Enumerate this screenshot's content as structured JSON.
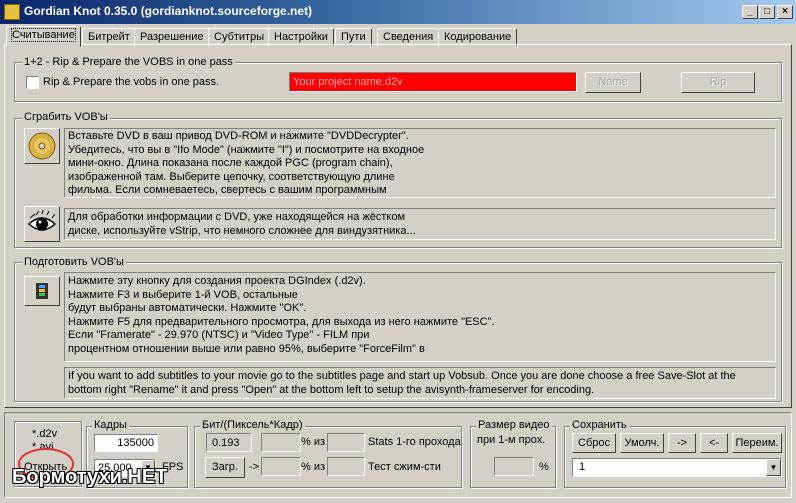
{
  "window": {
    "title": "Gordian Knot 0.35.0  (gordianknot.sourceforge.net)",
    "min": "_",
    "max": "□",
    "close": "×"
  },
  "tabs": [
    "Считывание",
    "Битрейт",
    "Разрешение",
    "Субтитры",
    "Настройки",
    "Пути",
    "Сведения",
    "Кодирование"
  ],
  "rip_group": {
    "legend": "1+2 - Rip & Prepare the VOBS in one pass",
    "checkbox_label": "Rip & Prepare the vobs in one pass.",
    "project_placeholder": "Your project name.d2v",
    "name_button": "Name",
    "rip_button": "Rip"
  },
  "grab_group": {
    "legend": "Сграбить VOB'ы",
    "dvd_text": "Вставьте DVD в ваш привод DVD-ROM и нажмите \"DVDDecrypter\". Убедитесь, что вы в \"Ifo Mode\" (нажмите \"I\") и посмотрите на входное мини-окно. Длина показана после каждой PGC (program chain), изображенной там. Выберите цепочку, соответствующую длине фильма. Если сомневаетесь, свертесь с вашим программным",
    "vstrip_text": "Для обработки информации с DVD, уже находящейся на жёстком диске, используйте vStrip, что немного сложнее для виндузятника..."
  },
  "prepare_group": {
    "legend": "Подготовить VOB'ы",
    "lines": [
      "Нажмите эту кнопку для создания проекта DGIndex (.d2v).",
      "Нажмите F3 и выберите 1-й VOB, остальные",
      "будут выбраны автоматически. Нажмите \"OK\".",
      "Нажмите F5 для предварительного просмотра, для выхода из него нажмите \"ESC\".",
      "Если \"Framerate\" - 29.970 (NTSC) и \"Video Type\" - FILM при",
      "процентном отношении выше или равно 95%, выберите \"ForceFilm\" в"
    ],
    "subtitle_note": "If you want to add subtitles to your movie go to the subtitles page and start up Vobsub. Once you are done choose a free Save-Slot at the bottom right \"Rename\" it and press \"Open\" at the bottom left to setup the avisynth-frameserver for encoding."
  },
  "bottom": {
    "ext_d2v": "*.d2v",
    "ext_avi": "*.avi",
    "open_button": "Открыть",
    "frames_label": "Кадры",
    "frames_value": "135000",
    "fps_value": "25.000",
    "fps_label": "FPS",
    "bits_label": "Бит/(Пиксель*Кадр)",
    "bits_value": "0.193",
    "pct_from_1": "% из",
    "stats_label": "Stats 1-го прохода",
    "load_button": "Загр.",
    "arrow": "->",
    "pct_from_2": "% из",
    "test_label": "Тест сжим-сти",
    "size_label_1": "Размер видео",
    "size_label_2": "при 1-м прох.",
    "size_pct": "%",
    "save_label": "Сохранить",
    "reset_button": "Сброс",
    "default_button": "Умолч.",
    "right_button": "->",
    "left_button": "<-",
    "rename_button": "Переим.",
    "slot_value": "1"
  },
  "watermark": "Бормотухи.НЕТ",
  "colors": {
    "project_field_bg": "#ff0000",
    "title_bar": "#0a246a",
    "annotation_circle": "#e03030"
  }
}
